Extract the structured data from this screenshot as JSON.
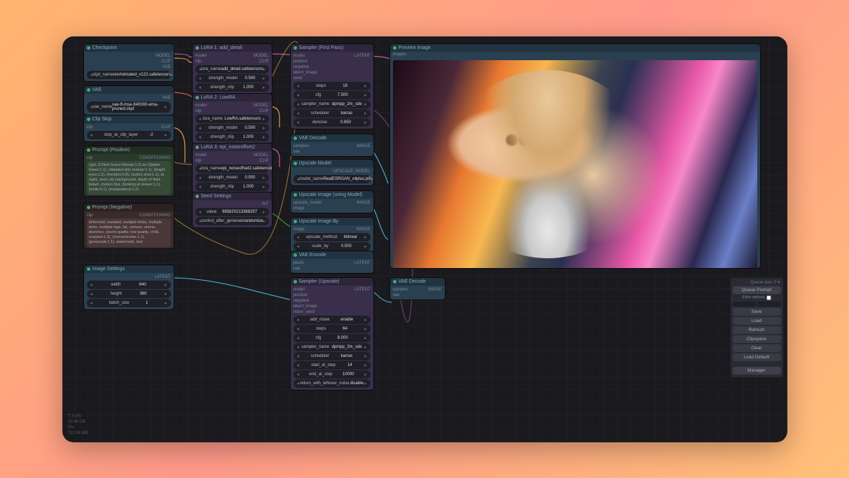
{
  "checkpoint": {
    "title": "Checkpoint",
    "out_model": "MODEL",
    "out_clip": "CLIP",
    "out_vae": "VAE",
    "ckpt_label": "ckpt_name",
    "ckpt_value": "revAnimated_v122.safetensors"
  },
  "vae": {
    "title": "VAE",
    "out": "VAE",
    "label": "vae_name",
    "value": "vae-ft-mse-840000-ema-pruned.ckpt"
  },
  "clipskip": {
    "title": "Clip Skip",
    "in_clip": "clip",
    "out_clip": "CLIP",
    "label": "stop_at_clip_layer",
    "value": "-2"
  },
  "pos": {
    "title": "Prompt (Positive)",
    "in_clip": "clip",
    "out": "CONDITIONING",
    "text": "1girl, (Chloë Grace Moretz:1.2) as (Spider Gwen:1.1), (detailed skin texture:1.1), (bright eyes:1.2), (freckles:0.8), (action shot:1.1), at night, neon city background, depth of field, bokeh, motion blur, (looking at viewer:1.1), (smile:0.1), (masterpiece:1.2)"
  },
  "neg": {
    "title": "Prompt (Negative)",
    "in_clip": "clip",
    "out": "CONDITIONING",
    "text": "deformed, mutated, multiple limbs, multiple arms, multiple legs, fat, cartoon, anime, sketches, (worst quality, low quality, child, cropped:1.2), (monochrome:1.1), (greyscale:1.1), watermark, text"
  },
  "imgset": {
    "title": "Image Settings",
    "out": "LATENT",
    "width_l": "width",
    "width_v": "640",
    "height_l": "height",
    "height_v": "360",
    "batch_l": "batch_size",
    "batch_v": "1"
  },
  "lora1": {
    "title": "LoRA 1: add_detail",
    "in_model": "model",
    "in_clip": "clip",
    "out_model": "MODEL",
    "out_clip": "CLIP",
    "name_l": "lora_name",
    "name_v": "add_detail.safetensors",
    "sm_l": "strength_model",
    "sm_v": "0.500",
    "sc_l": "strength_clip",
    "sc_v": "1.000"
  },
  "lora2": {
    "title": "LoRA 2: LowRA",
    "name_l": "lora_name",
    "name_v": "LowRA.safetensors",
    "sm_l": "strength_model",
    "sm_v": "0.500",
    "sc_l": "strength_clip",
    "sc_v": "1.000"
  },
  "lora3": {
    "title": "LoRA 3: epi_noiseoffset2",
    "name_l": "lora_name",
    "name_v": "epi_noiseoffset2.safetensors",
    "sm_l": "strength_model",
    "sm_v": "0.500",
    "sc_l": "strength_clip",
    "sc_v": "1.000"
  },
  "seed": {
    "title": "Seed Settings",
    "in": "",
    "val_l": "value",
    "val_v": "985820213388297",
    "ctrl_l": "control_after_generate",
    "ctrl_v": "randomize"
  },
  "sampler1": {
    "title": "Sampler (First Pass)",
    "in_model": "model",
    "in_pos": "positive",
    "in_neg": "negative",
    "in_latent": "latent_image",
    "in_seed": "seed",
    "out": "LATENT",
    "steps_l": "steps",
    "steps_v": "18",
    "cfg_l": "cfg",
    "cfg_v": "7.500",
    "name_l": "sampler_name",
    "name_v": "dpmpp_2m_sde",
    "sched_l": "scheduler",
    "sched_v": "karras",
    "den_l": "denoise",
    "den_v": "0.650"
  },
  "vaedec": {
    "title": "VAE Decode",
    "in_s": "samples",
    "in_v": "vae",
    "out": "IMAGE"
  },
  "upmodel": {
    "title": "Upscale Model",
    "out": "UPSCALE_MODEL",
    "label": "model_name",
    "value": "RealESRGAN_x4plus.pth"
  },
  "upimg": {
    "title": "Upscale Image (using Model)",
    "in_m": "upscale_model",
    "in_i": "image",
    "out": "IMAGE"
  },
  "upby": {
    "title": "Upscale Image By",
    "in": "image",
    "out": "IMAGE",
    "method_l": "upscale_method",
    "method_v": "bilinear",
    "scale_l": "scale_by",
    "scale_v": "0.500"
  },
  "vaeenc": {
    "title": "VAE Encode",
    "in_p": "pixels",
    "in_v": "vae",
    "out": "LATENT"
  },
  "sampler2": {
    "title": "Sampler (Upscale)",
    "in_model": "model",
    "in_pos": "positive",
    "in_neg": "negative",
    "in_latent": "latent_image",
    "in_seed": "noise_seed",
    "out": "LATENT",
    "add_l": "add_noise",
    "add_v": "enable",
    "steps_l": "steps",
    "steps_v": "64",
    "cfg_l": "cfg",
    "cfg_v": "8.000",
    "name_l": "sampler_name",
    "name_v": "dpmpp_2m_sde",
    "sched_l": "scheduler",
    "sched_v": "karras",
    "start_l": "start_at_step",
    "start_v": "14",
    "end_l": "end_at_step",
    "end_v": "10000",
    "ret_l": "return_with_leftover_noise",
    "ret_v": "disable"
  },
  "vaedec2": {
    "title": "VAE Decode",
    "in_s": "samples",
    "in_v": "vae",
    "out": "IMAGE"
  },
  "preview": {
    "title": "Preview Image",
    "in": "images"
  },
  "menu": {
    "queue_size": "Queue size: 0",
    "queue": "Queue Prompt",
    "extra": "Extra options",
    "save": "Save",
    "load": "Load",
    "refresh": "Refresh",
    "clipspace": "Clipspace",
    "clear": "Clear",
    "default": "Load Default",
    "manager": "Manager"
  },
  "info": {
    "l1": "T: 0.0%",
    "l2": "10.48 GB",
    "l3": "0%",
    "l4": "712.58 MB"
  }
}
